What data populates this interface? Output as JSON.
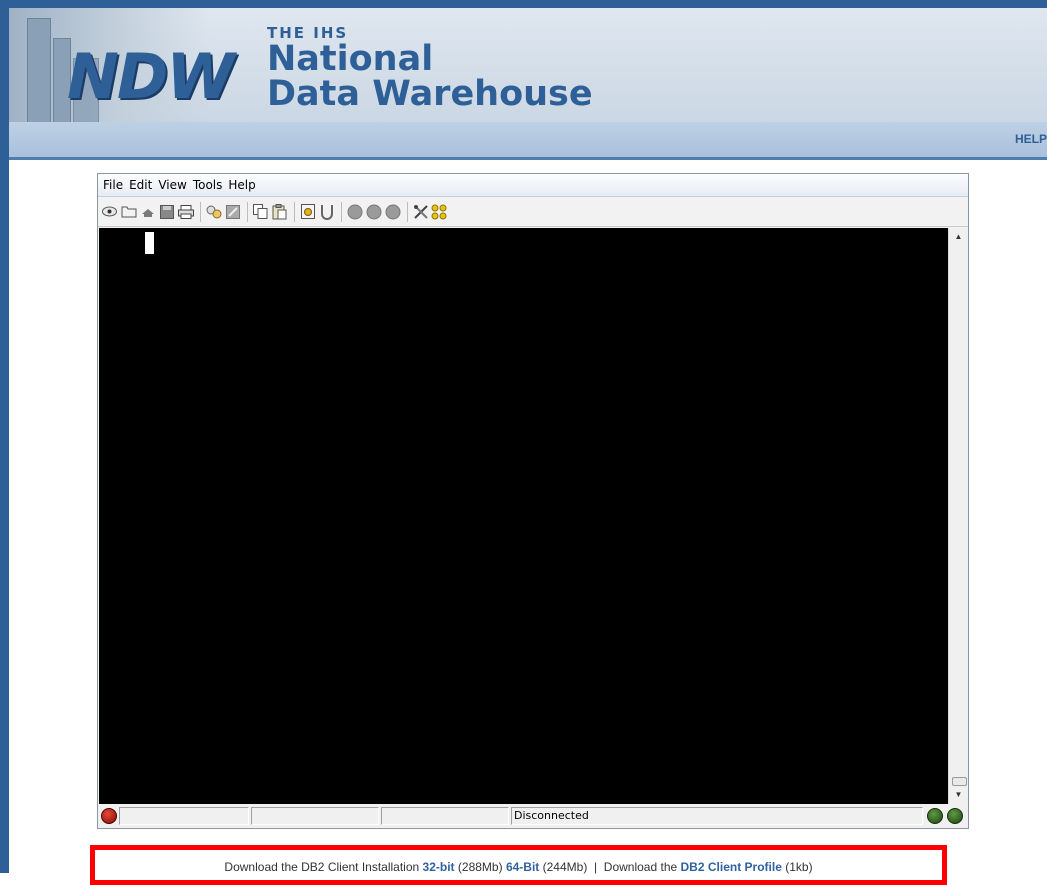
{
  "header": {
    "logo_mark": "NDW",
    "logo_small": "THE IHS",
    "logo_line1": "National",
    "logo_line2": "Data Warehouse"
  },
  "nav": {
    "help": "HELP"
  },
  "app": {
    "menu": [
      "File",
      "Edit",
      "View",
      "Tools",
      "Help"
    ],
    "toolbar_icons": [
      "connect-icon",
      "open-folder-icon",
      "disconnect-icon",
      "save-icon",
      "print-icon",
      "macro-icon",
      "record-icon",
      "copy-icon",
      "paste-icon",
      "transfer-icon",
      "keypad-icon",
      "button-1-icon",
      "button-2-icon",
      "button-3-icon",
      "settings-icon",
      "help-icon"
    ],
    "status": {
      "connection": "Disconnected"
    }
  },
  "download": {
    "prefix": "Download the DB2 Client Installation",
    "link32": "32-bit",
    "size32": "(288Mb)",
    "link64": "64-Bit",
    "size64": "(244Mb)",
    "separator": "|",
    "profile_prefix": "Download the",
    "profile_link": "DB2 Client Profile",
    "profile_size": "(1kb)"
  },
  "colors": {
    "brand_blue": "#2e5f96",
    "highlight_red": "#ff0000",
    "terminal_bg": "#000000"
  }
}
